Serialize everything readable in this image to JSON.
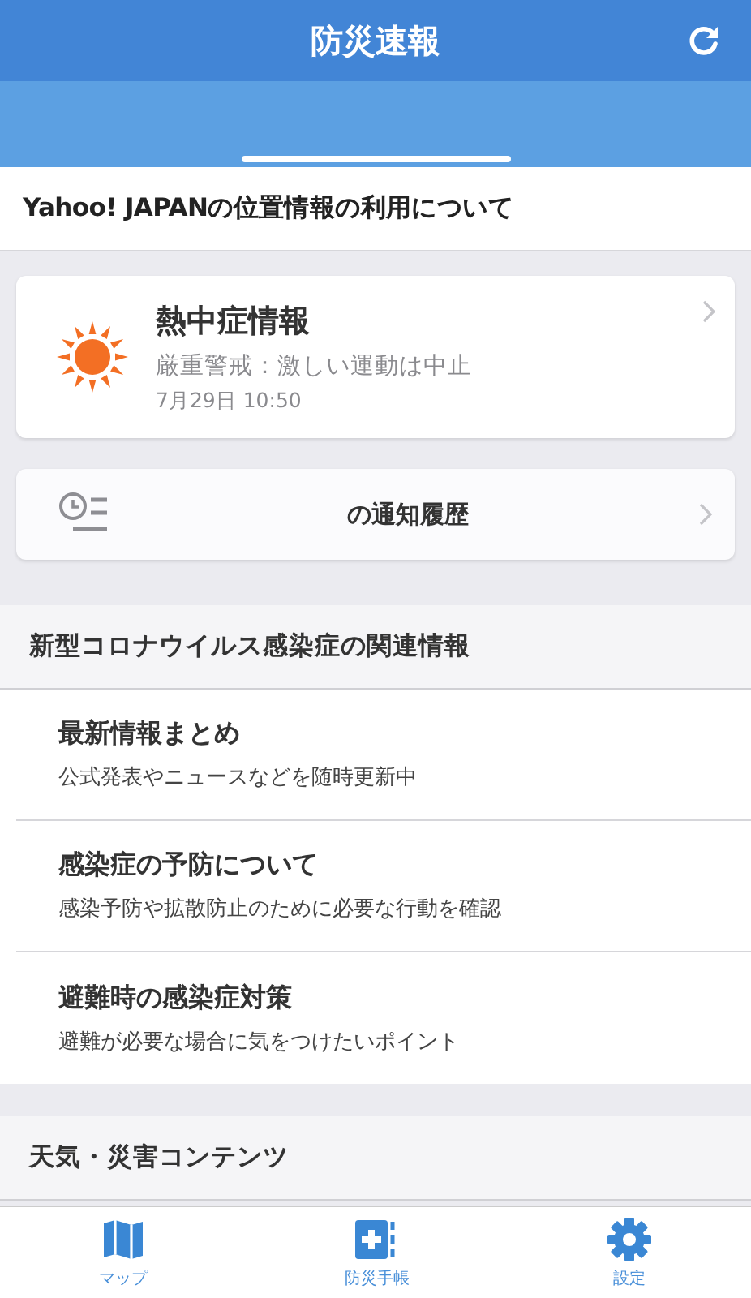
{
  "header": {
    "title": "防災速報"
  },
  "location_notice": "Yahoo! JAPANの位置情報の利用について",
  "alert_card": {
    "title": "熱中症情報",
    "message": "厳重警戒：激しい運動は中止",
    "time": "7月29日 10:50"
  },
  "history_card": {
    "label": "の通知履歴"
  },
  "sections": [
    {
      "title": "新型コロナウイルス感染症の関連情報",
      "items": [
        {
          "title": "最新情報まとめ",
          "subtitle": "公式発表やニュースなどを随時更新中"
        },
        {
          "title": "感染症の予防について",
          "subtitle": "感染予防や拡散防止のために必要な行動を確認"
        },
        {
          "title": "避難時の感染症対策",
          "subtitle": "避難が必要な場合に気をつけたいポイント"
        }
      ]
    },
    {
      "title": "天気・災害コンテンツ"
    }
  ],
  "tab_bar": [
    {
      "kind": "map",
      "label": "マップ"
    },
    {
      "kind": "handbook",
      "label": "防災手帳"
    },
    {
      "kind": "settings",
      "label": "設定"
    }
  ]
}
